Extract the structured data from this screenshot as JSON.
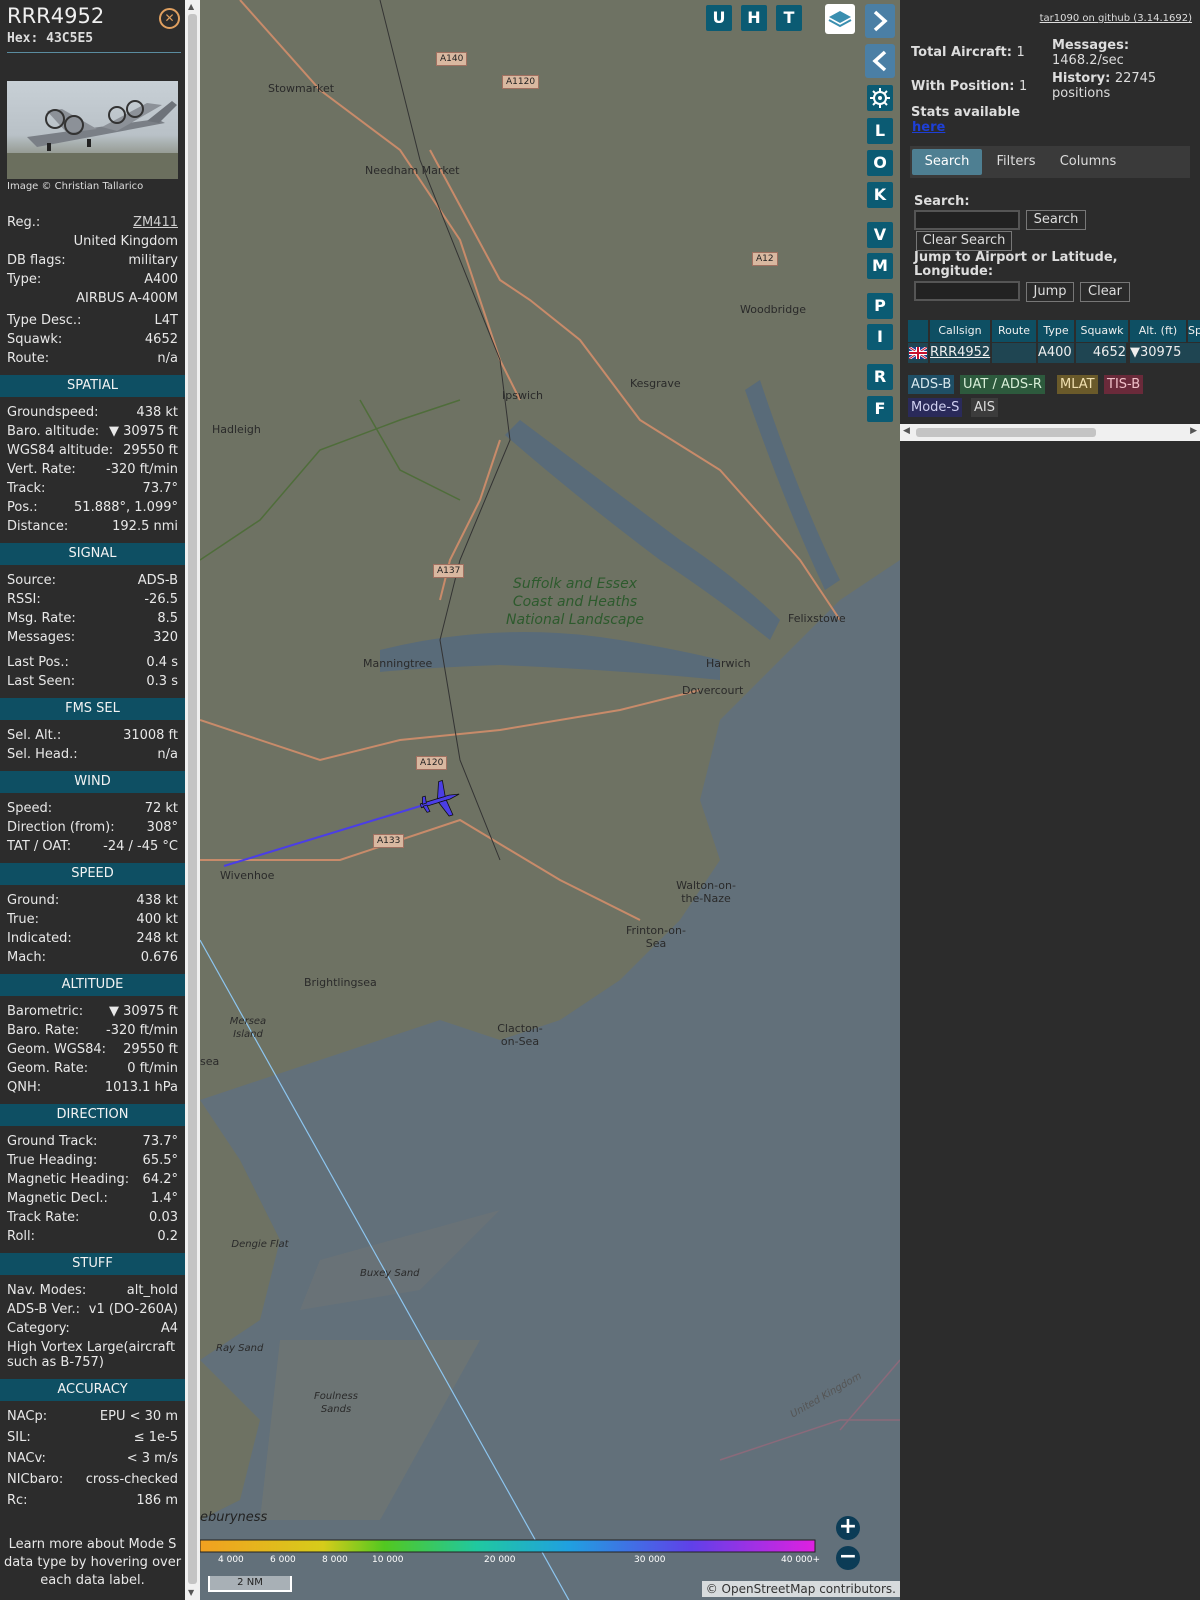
{
  "info": {
    "callsign": "RRR4952",
    "hex_label": "Hex:",
    "hex": "43C5E5",
    "close_icon": "close-circle-icon",
    "photo_credit": "Image © Christian Tallarico",
    "general": [
      {
        "k": "Reg.:",
        "v": "ZM411"
      },
      {
        "k": "",
        "v": "United Kingdom"
      },
      {
        "k": "DB flags:",
        "v": "military"
      },
      {
        "k": "Type:",
        "v": "A400"
      },
      {
        "k": "",
        "v": "AIRBUS A-400M"
      },
      {
        "k": "Type Desc.:",
        "v": "L4T"
      },
      {
        "k": "Squawk:",
        "v": "4652"
      },
      {
        "k": "Route:",
        "v": "n/a"
      }
    ],
    "spatial_title": "SPATIAL",
    "spatial": [
      {
        "k": "Groundspeed:",
        "v": "438 kt"
      },
      {
        "k": "Baro. altitude:",
        "v": "▼ 30975 ft"
      },
      {
        "k": "WGS84 altitude:",
        "v": "29550 ft"
      },
      {
        "k": "Vert. Rate:",
        "v": "-320 ft/min"
      },
      {
        "k": "Track:",
        "v": "73.7°"
      },
      {
        "k": "Pos.:",
        "v": "51.888°, 1.099°"
      },
      {
        "k": "Distance:",
        "v": "192.5 nmi"
      }
    ],
    "signal_title": "SIGNAL",
    "signal": [
      {
        "k": "Source:",
        "v": "ADS-B"
      },
      {
        "k": "RSSI:",
        "v": "-26.5"
      },
      {
        "k": "Msg. Rate:",
        "v": "8.5"
      },
      {
        "k": "Messages:",
        "v": "320"
      },
      {
        "k": "Last Pos.:",
        "v": "0.4 s"
      },
      {
        "k": "Last Seen:",
        "v": "0.3 s"
      }
    ],
    "fms_title": "FMS SEL",
    "fms": [
      {
        "k": "Sel. Alt.:",
        "v": "31008 ft"
      },
      {
        "k": "Sel. Head.:",
        "v": "n/a"
      }
    ],
    "wind_title": "WIND",
    "wind": [
      {
        "k": "Speed:",
        "v": "72 kt"
      },
      {
        "k": "Direction (from):",
        "v": "308°"
      },
      {
        "k": "TAT / OAT:",
        "v": "-24 / -45 °C"
      }
    ],
    "speed_title": "SPEED",
    "speed": [
      {
        "k": "Ground:",
        "v": "438 kt"
      },
      {
        "k": "True:",
        "v": "400 kt"
      },
      {
        "k": "Indicated:",
        "v": "248 kt"
      },
      {
        "k": "Mach:",
        "v": "0.676"
      }
    ],
    "altitude_title": "ALTITUDE",
    "altitude": [
      {
        "k": "Barometric:",
        "v": "▼ 30975 ft"
      },
      {
        "k": "Baro. Rate:",
        "v": "-320 ft/min"
      },
      {
        "k": "Geom. WGS84:",
        "v": "29550 ft"
      },
      {
        "k": "Geom. Rate:",
        "v": "0 ft/min"
      },
      {
        "k": "QNH:",
        "v": "1013.1 hPa"
      }
    ],
    "direction_title": "DIRECTION",
    "direction": [
      {
        "k": "Ground Track:",
        "v": "73.7°"
      },
      {
        "k": "True Heading:",
        "v": "65.5°"
      },
      {
        "k": "Magnetic Heading:",
        "v": "64.2°"
      },
      {
        "k": "Magnetic Decl.:",
        "v": "1.4°"
      },
      {
        "k": "Track Rate:",
        "v": "0.03"
      },
      {
        "k": "Roll:",
        "v": "0.2"
      }
    ],
    "stuff_title": "STUFF",
    "stuff": [
      {
        "k": "Nav. Modes:",
        "v": "alt_hold"
      },
      {
        "k": "ADS-B Ver.:",
        "v": "v1 (DO-260A)"
      },
      {
        "k": "Category:",
        "v": "A4"
      }
    ],
    "wake_text": "High Vortex Large(aircraft such as B-757)",
    "accuracy_title": "ACCURACY",
    "accuracy": [
      {
        "k": "NACp:",
        "v": "EPU < 30 m"
      },
      {
        "k": "SIL:",
        "v": "≤ 1e-5"
      },
      {
        "k": "NACv:",
        "v": "< 3 m/s"
      },
      {
        "k": "NICbaro:",
        "v": "cross-checked"
      },
      {
        "k": "Rc:",
        "v": "186 m"
      }
    ],
    "learn_more": "Learn more about Mode S data type by hovering over each data label."
  },
  "map": {
    "places": [
      {
        "name": "Stowmarket"
      },
      {
        "name": "Needham Market"
      },
      {
        "name": "Woodbridge"
      },
      {
        "name": "Ipswich"
      },
      {
        "name": "Kesgrave"
      },
      {
        "name": "Hadleigh"
      },
      {
        "name": "Felixstowe"
      },
      {
        "name": "Manningtree"
      },
      {
        "name": "Harwich"
      },
      {
        "name": "Dovercourt"
      },
      {
        "name": "Wivenhoe"
      },
      {
        "name": "Walton-on-the-Naze"
      },
      {
        "name": "Frinton-on-Sea"
      },
      {
        "name": "Brightlingsea"
      },
      {
        "name": "Clacton-on-Sea"
      },
      {
        "name": "Mersea Island"
      },
      {
        "name": "Buxey Sand"
      },
      {
        "name": "Dengie Flat"
      },
      {
        "name": "Ray Sand"
      },
      {
        "name": "Foulness Sands"
      },
      {
        "name": "United Kingdom"
      },
      {
        "name": "eburyness"
      },
      {
        "name": "sea"
      }
    ],
    "roads": [
      "A140",
      "A1120",
      "A12",
      "A137",
      "A120",
      "A133"
    ],
    "park_label": "Suffolk and Essex Coast and Heaths National Landscape",
    "controls_top": [
      "U",
      "H",
      "T"
    ],
    "controls_side": [
      "L",
      "O",
      "K",
      "V",
      "M",
      "P",
      "I",
      "R",
      "F"
    ],
    "settings_icon": "gear-icon",
    "layers_icon": "layers-icon",
    "legend_labels": [
      "4 000",
      "6 000",
      "8 000",
      "10 000",
      "20 000",
      "30 000",
      "40 000+"
    ],
    "scale_label": "2 NM",
    "attribution": "© OpenStreetMap contributors."
  },
  "right": {
    "github": "tar1090 on github (3.14.1692)",
    "total_aircraft_label": "Total Aircraft:",
    "total_aircraft": "1",
    "with_position_label": "With Position:",
    "with_position": "1",
    "messages_label": "Messages:",
    "messages_rate": "1468.2/sec",
    "history_label": "History:",
    "history_value": "22745 positions",
    "stats_label": "Stats available",
    "stats_link": "here",
    "tabs": [
      "Search",
      "Filters",
      "Columns"
    ],
    "search_label": "Search:",
    "search_button": "Search",
    "clear_search_button": "Clear Search",
    "jump_label": "Jump to Airport or Latitude, Longitude:",
    "jump_button": "Jump",
    "clear_button": "Clear",
    "table": {
      "headers": [
        "Callsign",
        "Route",
        "Type",
        "Squawk",
        "Alt. (ft)",
        "Sp"
      ],
      "row": {
        "callsign": "RRR4952",
        "route": "",
        "type": "A400",
        "squawk": "4652",
        "alt": "▼30975"
      }
    },
    "chips": [
      "ADS-B",
      "UAT / ADS-R",
      "MLAT",
      "TIS-B",
      "Mode-S",
      "AIS"
    ],
    "colors": {
      "section": "#0e4f63",
      "accent": "#4e7f92"
    }
  }
}
